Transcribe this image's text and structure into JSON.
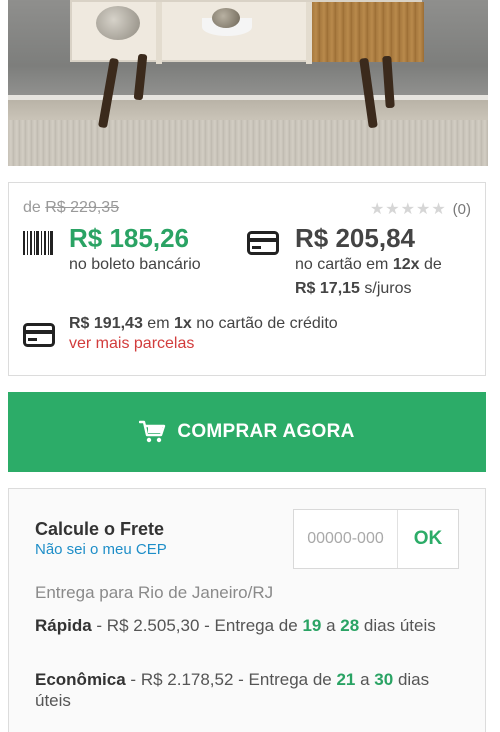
{
  "price": {
    "old_prefix": "de",
    "old_price": "R$ 229,35",
    "rating_count": "(0)",
    "boleto_price": "R$ 185,26",
    "boleto_note": "no boleto bancário",
    "card_price": "R$ 205,84",
    "card_note_prefix": "no cartão em",
    "card_installments": "12x",
    "card_note_suffix": "de",
    "card_installment_value": "R$ 17,15",
    "card_interest_note": "s/juros",
    "onex_price": "R$ 191,43",
    "onex_mid": "em",
    "onex_count": "1x",
    "onex_suffix": "no cartão de crédito",
    "more_parcelas": "ver mais parcelas"
  },
  "buy_button": {
    "label": "COMPRAR AGORA"
  },
  "freight": {
    "title": "Calcule o Frete",
    "unknown_cep": "Não sei o meu CEP",
    "cep_placeholder": "00000-000",
    "ok_label": "OK",
    "deliver_to": "Entrega para Rio de Janeiro/RJ",
    "options": [
      {
        "name": "Rápida",
        "sep1": " - ",
        "price": "R$ 2.505,30",
        "sep2": " - Entrega de ",
        "min_days": "19",
        "between": " a ",
        "max_days": "28",
        "suffix": " dias úteis"
      },
      {
        "name": "Econômica",
        "sep1": " - ",
        "price": "R$ 2.178,52",
        "sep2": " - Entrega de ",
        "min_days": "21",
        "between": " a ",
        "max_days": "30",
        "suffix": " dias úteis"
      }
    ]
  },
  "colors": {
    "green": "#2cac68",
    "price_green": "#2aa364",
    "link_blue": "#1e8ec8",
    "link_red": "#d23c3c"
  },
  "icons": {
    "barcode": "barcode-icon",
    "card": "credit-card-icon",
    "cart": "cart-icon",
    "star": "star-icon"
  }
}
